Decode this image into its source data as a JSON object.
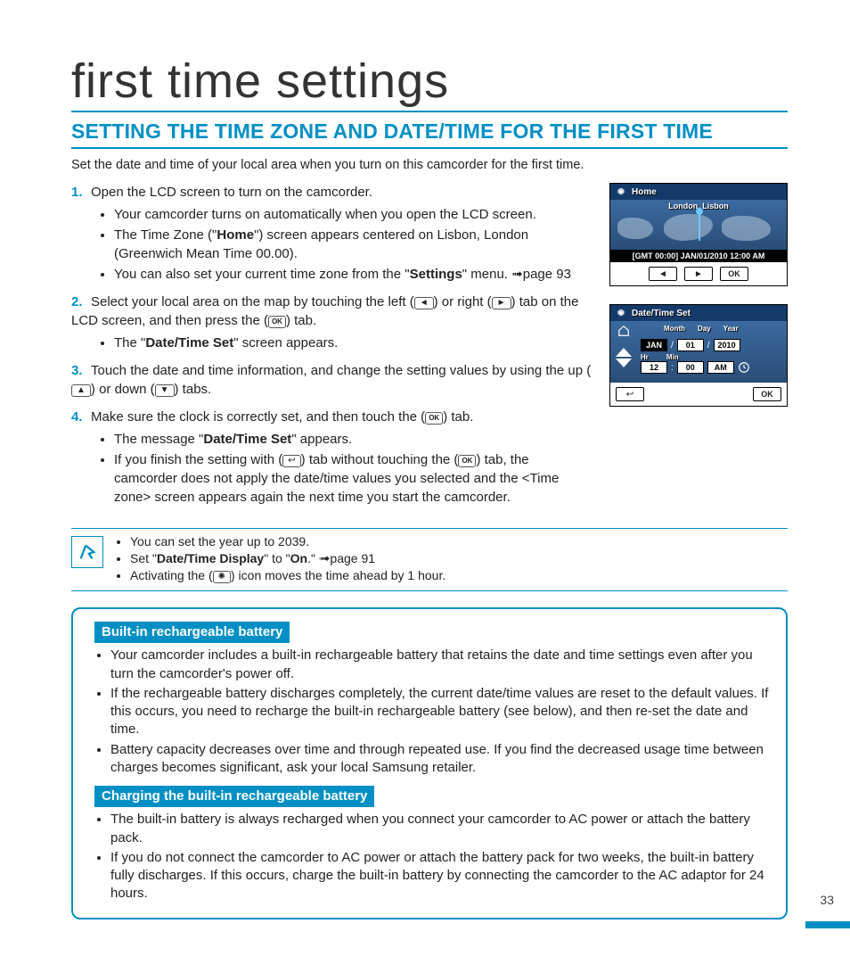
{
  "page_title": "first time settings",
  "section_title": "SETTING THE TIME ZONE AND DATE/TIME FOR THE FIRST TIME",
  "intro": "Set the date and time of your local area when you turn on this camcorder for the first time.",
  "steps": {
    "s1": {
      "num": "1.",
      "text": "Open the LCD screen to turn on the camcorder.",
      "b1": "Your camcorder turns on automatically when you open the LCD screen.",
      "b2a": "The Time Zone (\"",
      "b2b": "Home",
      "b2c": "\") screen appears centered on Lisbon, London (Greenwich Mean Time 00.00).",
      "b3a": "You can also set your current time zone from the \"",
      "b3b": "Settings",
      "b3c": "\" menu. ",
      "b3d": "page 93"
    },
    "s2": {
      "num": "2.",
      "text_a": "Select your local area on the map by touching the left (",
      "text_b": ") or right (",
      "text_c": ") tab on the LCD screen, and then press the (",
      "text_d": ") tab.",
      "b1a": "The \"",
      "b1b": "Date/Time Set",
      "b1c": "\" screen appears."
    },
    "s3": {
      "num": "3.",
      "text_a": "Touch the date and time information, and change the setting values by using the up (",
      "text_b": ") or down (",
      "text_c": ") tabs."
    },
    "s4": {
      "num": "4.",
      "text_a": "Make sure the clock is correctly set, and then touch the (",
      "text_b": ") tab.",
      "b1a": "The message \"",
      "b1b": "Date/Time Set",
      "b1c": "\" appears.",
      "b2a": "If you finish the setting with (",
      "b2b": ") tab without touching the (",
      "b2c": ") tab, the camcorder does not apply the date/time values you selected and the <Time zone> screen appears again the next time you start the camcorder."
    }
  },
  "note": {
    "n1": "You can set the year up to 2039.",
    "n2a": "Set \"",
    "n2b": "Date/Time Display",
    "n2c": "\" to \"",
    "n2d": "On",
    "n2e": ".\" ",
    "n2f": "page 91",
    "n3a": "Activating the (",
    "n3b": ") icon moves the time ahead by 1 hour."
  },
  "box": {
    "tag1": "Built-in rechargeable battery",
    "b1": "Your camcorder includes a built-in rechargeable battery that retains the date and time settings even after you turn the camcorder's power off.",
    "b2": "If the rechargeable battery discharges completely, the current date/time values are reset to the default values. If this occurs, you need to recharge the built-in rechargeable battery (see below), and then re-set the date and time.",
    "b3": "Battery capacity decreases over time and through repeated use. If you find the decreased usage time between charges becomes significant, ask your local Samsung retailer.",
    "tag2": "Charging the built-in rechargeable battery",
    "c1": "The built-in battery is always recharged when you connect your camcorder to AC power or attach the battery pack.",
    "c2": "If you do not connect the camcorder to AC power or attach the battery pack for two weeks, the built-in battery fully discharges. If this occurs, charge the built-in battery by connecting the camcorder to the AC adaptor for 24 hours."
  },
  "device1": {
    "title": "Home",
    "city": "London, Lisbon",
    "gmt": "[GMT 00:00] JAN/01/2010 12:00 AM",
    "ok": "OK",
    "left": "◄",
    "right": "►"
  },
  "device2": {
    "title": "Date/Time Set",
    "lbl_month": "Month",
    "lbl_day": "Day",
    "lbl_year": "Year",
    "lbl_hr": "Hr",
    "lbl_min": "Min",
    "month": "JAN",
    "day": "01",
    "year": "2010",
    "hr": "12",
    "min": "00",
    "ampm": "AM",
    "back": "↩",
    "ok": "OK"
  },
  "inline": {
    "left": "◄",
    "right": "►",
    "ok": "OK",
    "up": "▲",
    "down": "▼",
    "back": "↩",
    "dst": "✺"
  },
  "page_number": "33"
}
